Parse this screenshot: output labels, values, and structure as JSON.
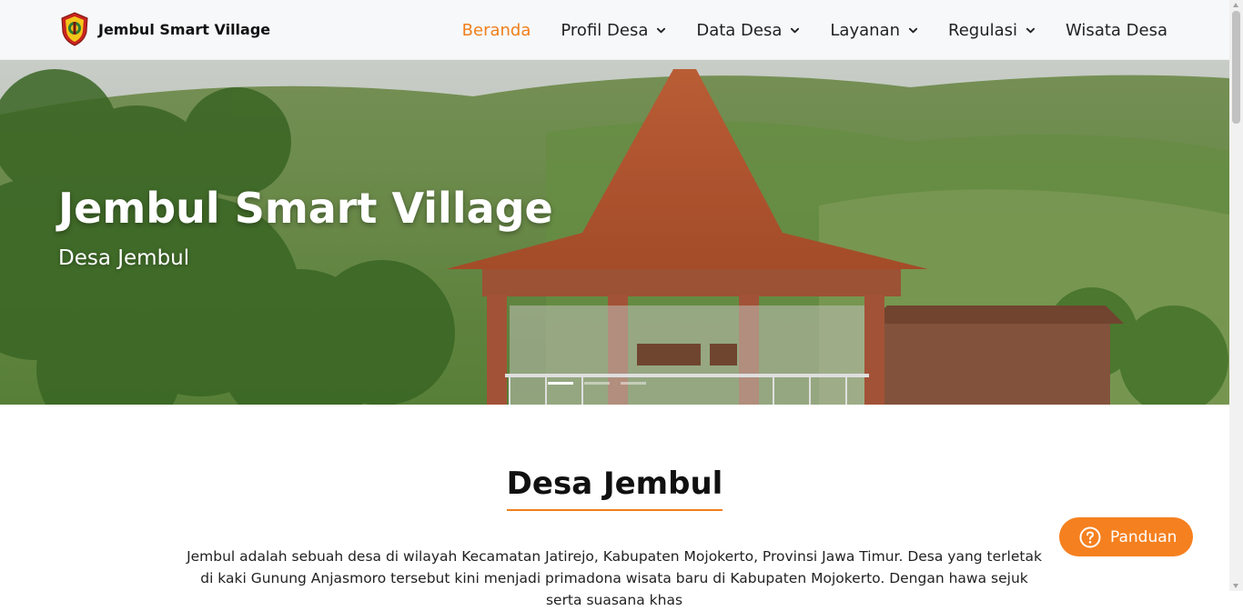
{
  "brand": {
    "name": "Jembul Smart Village",
    "logo_icon": "village-emblem-icon"
  },
  "nav": {
    "items": [
      {
        "label": "Beranda",
        "active": true,
        "has_dropdown": false
      },
      {
        "label": "Profil Desa",
        "active": false,
        "has_dropdown": true
      },
      {
        "label": "Data Desa",
        "active": false,
        "has_dropdown": true
      },
      {
        "label": "Layanan",
        "active": false,
        "has_dropdown": true
      },
      {
        "label": "Regulasi",
        "active": false,
        "has_dropdown": true
      },
      {
        "label": "Wisata Desa",
        "active": false,
        "has_dropdown": false
      }
    ]
  },
  "hero": {
    "title": "Jembul Smart Village",
    "subtitle": "Desa Jembul",
    "slide_count": 3,
    "active_slide": 1
  },
  "section": {
    "title": "Desa Jembul",
    "intro": "Jembul adalah sebuah desa di wilayah Kecamatan Jatirejo, Kabupaten Mojokerto, Provinsi Jawa Timur. Desa yang terletak di kaki Gunung Anjasmoro tersebut kini menjadi primadona wisata baru di Kabupaten Mojokerto. Dengan hawa sejuk serta suasana khas"
  },
  "help_button": {
    "label": "Panduan",
    "icon": "question-circle-icon"
  },
  "colors": {
    "accent": "#f07f1b",
    "nav_bg": "#f7f8fa",
    "help_bg": "#f5801f"
  }
}
